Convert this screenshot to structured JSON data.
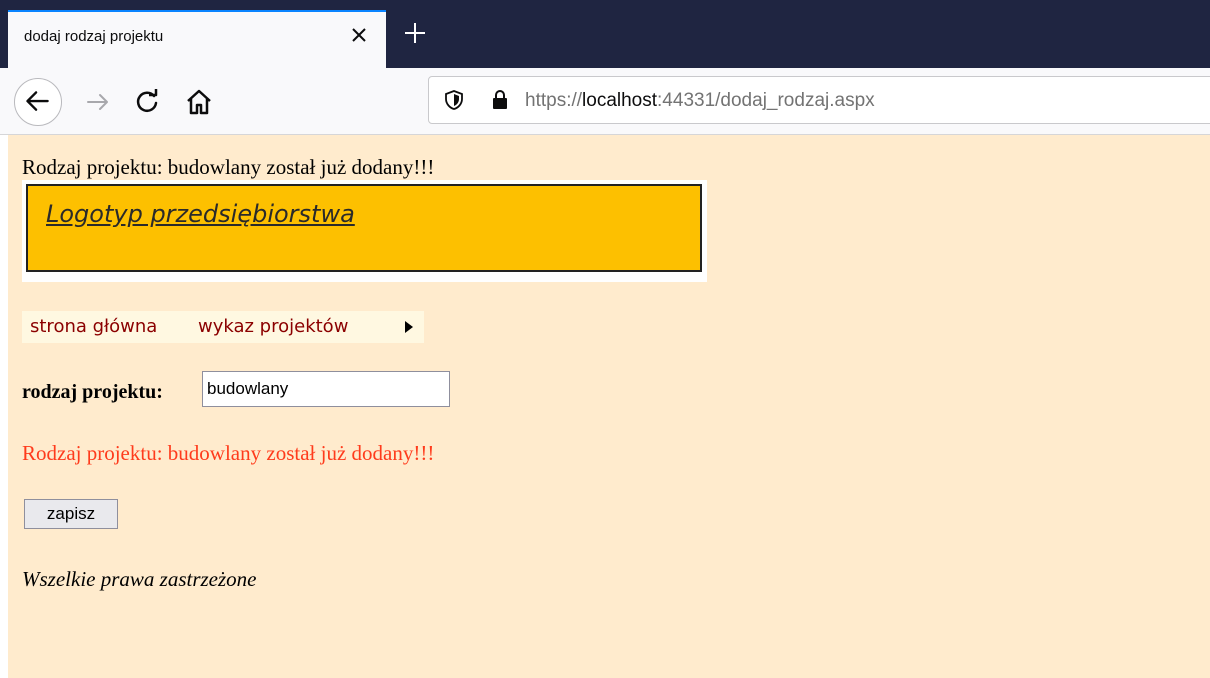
{
  "browser": {
    "tab_title": "dodaj rodzaj projektu",
    "url_prefix": "https://",
    "url_host": "localhost",
    "url_rest": ":44331/dodaj_rodzaj.aspx"
  },
  "page": {
    "top_message": "Rodzaj projektu: budowlany został już dodany!!!",
    "logo_text": "Logotyp przedsiębiorstwa",
    "menu": {
      "items": [
        {
          "label": "strona główna"
        },
        {
          "label": "wykaz projektów"
        }
      ]
    },
    "form": {
      "label": "rodzaj projektu:",
      "input_value": "budowlany",
      "error_message": "Rodzaj projektu: budowlany został już dodany!!!",
      "save_label": "zapisz"
    },
    "footer": "Wszelkie prawa zastrzeżone"
  },
  "colors": {
    "page_background": "#ffebcd",
    "logo_background": "#fdc000",
    "menu_text": "#8b0000",
    "error_text": "#ff3b1c",
    "tabbar": "#1f2541"
  }
}
